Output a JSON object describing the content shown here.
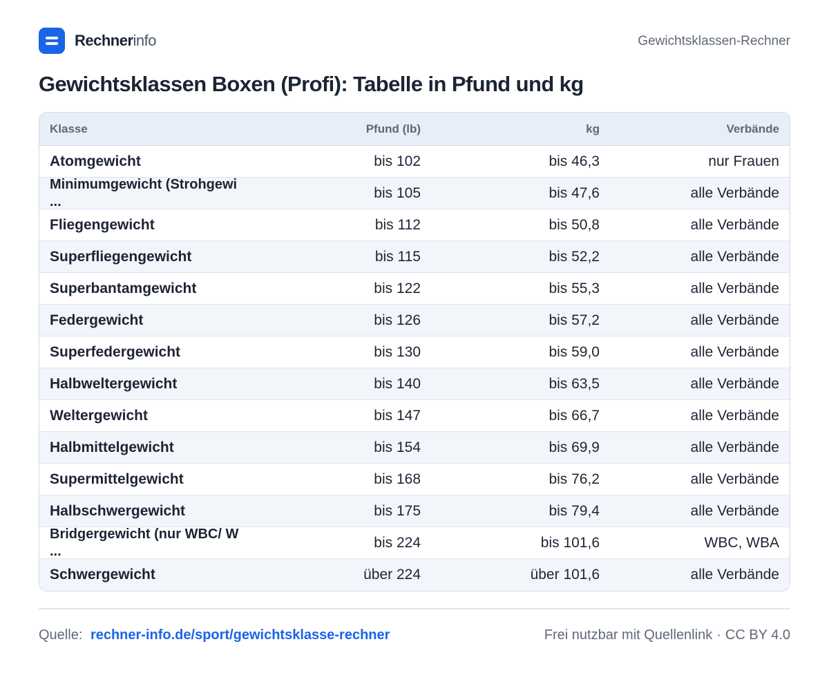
{
  "brand": {
    "name_bold": "Rechner",
    "name_light": "info"
  },
  "header": {
    "page_label": "Gewichtsklassen-Rechner"
  },
  "title": "Gewichtsklassen Boxen (Profi): Tabelle in Pfund und kg",
  "table": {
    "columns": [
      "Klasse",
      "Pfund (lb)",
      "kg",
      "Verbände"
    ],
    "rows": [
      {
        "klasse": "Atomgewicht",
        "pfund": "bis 102",
        "kg": "bis 46,3",
        "verbaende": "nur Frauen"
      },
      {
        "klasse": "Minimumgewicht (Strohgewi ...",
        "pfund": "bis 105",
        "kg": "bis 47,6",
        "verbaende": "alle Verbände"
      },
      {
        "klasse": "Fliegengewicht",
        "pfund": "bis 112",
        "kg": "bis 50,8",
        "verbaende": "alle Verbände"
      },
      {
        "klasse": "Superfliegengewicht",
        "pfund": "bis 115",
        "kg": "bis 52,2",
        "verbaende": "alle Verbände"
      },
      {
        "klasse": "Superbantamgewicht",
        "pfund": "bis 122",
        "kg": "bis 55,3",
        "verbaende": "alle Verbände"
      },
      {
        "klasse": "Federgewicht",
        "pfund": "bis 126",
        "kg": "bis 57,2",
        "verbaende": "alle Verbände"
      },
      {
        "klasse": "Superfedergewicht",
        "pfund": "bis 130",
        "kg": "bis 59,0",
        "verbaende": "alle Verbände"
      },
      {
        "klasse": "Halbweltergewicht",
        "pfund": "bis 140",
        "kg": "bis 63,5",
        "verbaende": "alle Verbände"
      },
      {
        "klasse": "Weltergewicht",
        "pfund": "bis 147",
        "kg": "bis 66,7",
        "verbaende": "alle Verbände"
      },
      {
        "klasse": "Halbmittelgewicht",
        "pfund": "bis 154",
        "kg": "bis 69,9",
        "verbaende": "alle Verbände"
      },
      {
        "klasse": "Supermittelgewicht",
        "pfund": "bis 168",
        "kg": "bis 76,2",
        "verbaende": "alle Verbände"
      },
      {
        "klasse": "Halbschwergewicht",
        "pfund": "bis 175",
        "kg": "bis 79,4",
        "verbaende": "alle Verbände"
      },
      {
        "klasse": "Bridgergewicht (nur WBC/ W ...",
        "pfund": "bis 224",
        "kg": "bis 101,6",
        "verbaende": "WBC, WBA"
      },
      {
        "klasse": "Schwergewicht",
        "pfund": "über 224",
        "kg": "über 101,6",
        "verbaende": "alle Verbände"
      }
    ]
  },
  "footer": {
    "source_label": "Quelle:",
    "source_link": "rechner-info.de/sport/gewichtsklasse-rechner",
    "usage": "Frei nutzbar mit Quellenlink",
    "separator": "·",
    "license": "CC BY 4.0"
  },
  "colors": {
    "accent": "#1a64e8",
    "text": "#1c2434",
    "muted": "#5f6877",
    "header_bg": "#e8eef7",
    "row_alt_bg": "#f2f5fa",
    "border": "#d4dae4"
  }
}
